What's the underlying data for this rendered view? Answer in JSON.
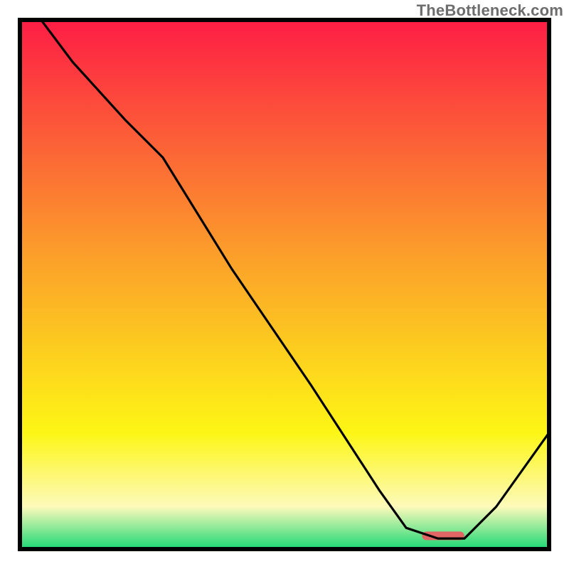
{
  "watermark": "TheBottleneck.com",
  "colors": {
    "red": "#fd1d45",
    "orange": "#fca02a",
    "yellow": "#fdf615",
    "paleYellow": "#fdfabb",
    "green": "#1bd874",
    "border": "#000000",
    "line": "#000000",
    "marker": "#e06666"
  },
  "chart_data": {
    "type": "line",
    "title": "",
    "xlabel": "",
    "ylabel": "",
    "xlim": [
      0,
      100
    ],
    "ylim": [
      0,
      100
    ],
    "grid": false,
    "legend": null,
    "series": [
      {
        "name": "curve",
        "x": [
          4,
          10,
          20,
          27,
          40,
          55,
          68,
          73,
          79,
          84,
          90,
          100
        ],
        "y": [
          100,
          92,
          81,
          74,
          53,
          31,
          11,
          4,
          2,
          2,
          8,
          22
        ]
      }
    ],
    "marker": {
      "x_start": 76,
      "x_end": 84,
      "y": 2.5,
      "color": "#e06666"
    }
  }
}
